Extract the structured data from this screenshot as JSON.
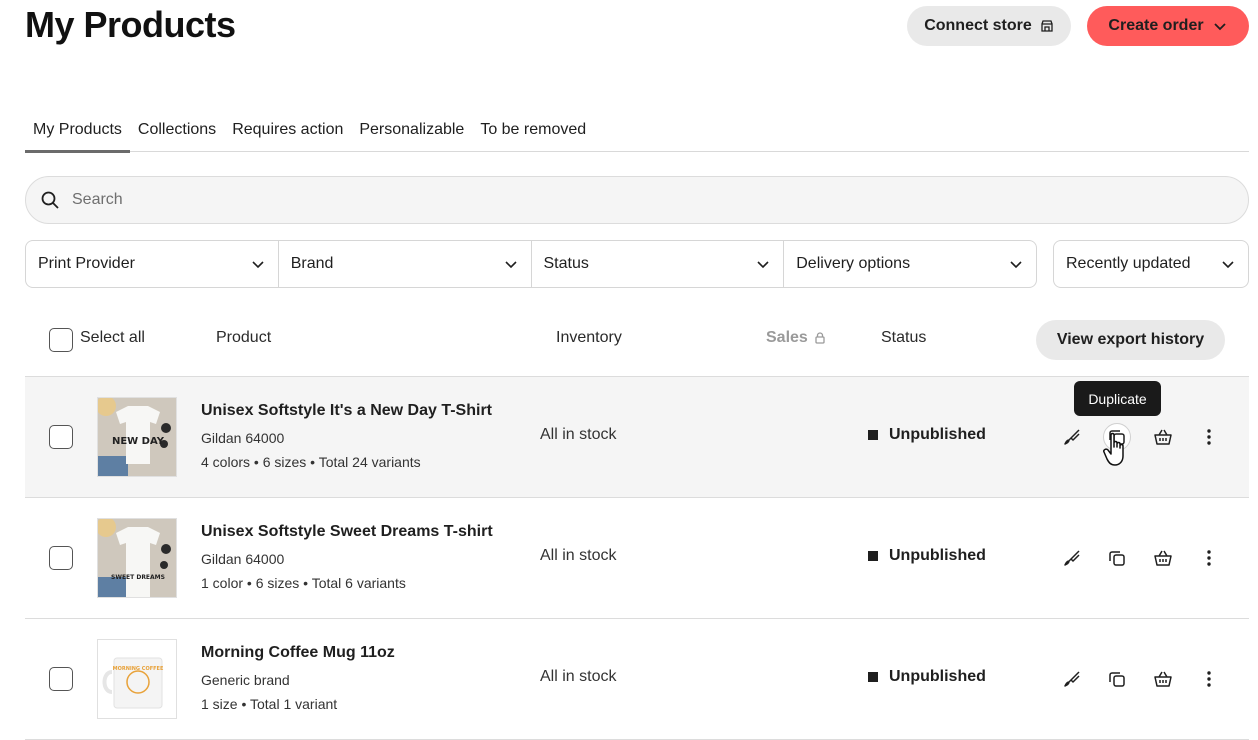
{
  "header": {
    "title": "My Products",
    "connect_store_label": "Connect store",
    "create_order_label": "Create order"
  },
  "tabs": [
    {
      "label": "My Products",
      "active": true
    },
    {
      "label": "Collections"
    },
    {
      "label": "Requires action"
    },
    {
      "label": "Personalizable"
    },
    {
      "label": "To be removed"
    }
  ],
  "search": {
    "placeholder": "Search"
  },
  "filters": [
    {
      "label": "Print Provider"
    },
    {
      "label": "Brand"
    },
    {
      "label": "Status"
    },
    {
      "label": "Delivery options"
    }
  ],
  "sort": {
    "label": "Recently updated"
  },
  "table": {
    "select_all": "Select all",
    "col_product": "Product",
    "col_inventory": "Inventory",
    "col_sales": "Sales",
    "col_status": "Status",
    "export_label": "View export history"
  },
  "tooltip": "Duplicate",
  "products": [
    {
      "title": "Unisex Softstyle It's a New Day T-Shirt",
      "brand": "Gildan 64000",
      "variants": "4 colors • 6 sizes • Total 24 variants",
      "inventory": "All in stock",
      "status": "Unpublished",
      "thumb_text": "NEW DAY"
    },
    {
      "title": "Unisex Softstyle Sweet Dreams T-shirt",
      "brand": "Gildan 64000",
      "variants": "1 color • 6 sizes • Total 6 variants",
      "inventory": "All in stock",
      "status": "Unpublished",
      "thumb_text": "SWEET DREAMS"
    },
    {
      "title": "Morning Coffee Mug 11oz",
      "brand": "Generic brand",
      "variants": "1 size • Total 1 variant",
      "inventory": "All in stock",
      "status": "Unpublished",
      "thumb_text": "MORNING COFFEE"
    }
  ],
  "colors": {
    "accent": "#ff5b5b",
    "button_grey": "#e9e9e9"
  }
}
